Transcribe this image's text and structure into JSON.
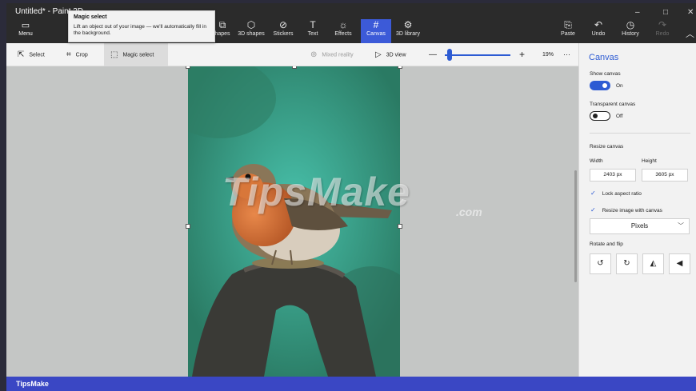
{
  "window": {
    "title": "Untitled* - Paint 3D",
    "controls": {
      "minimize": "–",
      "maximize": "□",
      "close": "✕"
    }
  },
  "ribbon": {
    "menu": {
      "icon": "folder-icon",
      "label": "Menu"
    },
    "items": [
      {
        "label": "2D shapes",
        "icon": "shapes-icon",
        "visible_label": "hapes"
      },
      {
        "label": "3D shapes",
        "icon": "cube-icon"
      },
      {
        "label": "Stickers",
        "icon": "sticker-icon"
      },
      {
        "label": "Text",
        "icon": "text-icon"
      },
      {
        "label": "Effects",
        "icon": "sun-icon"
      },
      {
        "label": "Canvas",
        "icon": "canvas-icon",
        "active": true
      },
      {
        "label": "3D library",
        "icon": "library-icon"
      }
    ],
    "right_items": [
      {
        "label": "Paste",
        "icon": "paste-icon"
      },
      {
        "label": "Undo",
        "icon": "undo-icon"
      },
      {
        "label": "History",
        "icon": "history-icon"
      },
      {
        "label": "Redo",
        "icon": "redo-icon",
        "disabled": true
      }
    ],
    "collapse_icon": "chevron-up-icon"
  },
  "tooltip": {
    "title": "Magic select",
    "body": "Lift an object out of your image — we'll automatically fill in the background."
  },
  "toolbar": {
    "select": "Select",
    "crop": "Crop",
    "magic_select": "Magic select",
    "mixed_reality": "Mixed reality",
    "view_3d": "3D view",
    "zoom_out": "—",
    "zoom_in": "+",
    "zoom_level": "19%",
    "more": "···",
    "zoom_fraction": 0.05
  },
  "canvas": {
    "watermark": "TipsMake",
    "watermark_suffix": ".com"
  },
  "panel": {
    "title": "Canvas",
    "show_canvas": {
      "label": "Show canvas",
      "state": "On"
    },
    "transparent_canvas": {
      "label": "Transparent canvas",
      "state": "Off"
    },
    "resize_canvas": "Resize canvas",
    "width_label": "Width",
    "height_label": "Height",
    "width_value": "2403 px",
    "height_value": "3605 px",
    "lock_aspect": "Lock aspect ratio",
    "resize_image": "Resize image with canvas",
    "unit": "Pixels",
    "rotate_flip": "Rotate and flip"
  },
  "status": {
    "brand": "TipsMake"
  },
  "colors": {
    "accent": "#2d5bd3",
    "ribbon": "#2b2b2b",
    "status_bar": "#3a47c4"
  }
}
